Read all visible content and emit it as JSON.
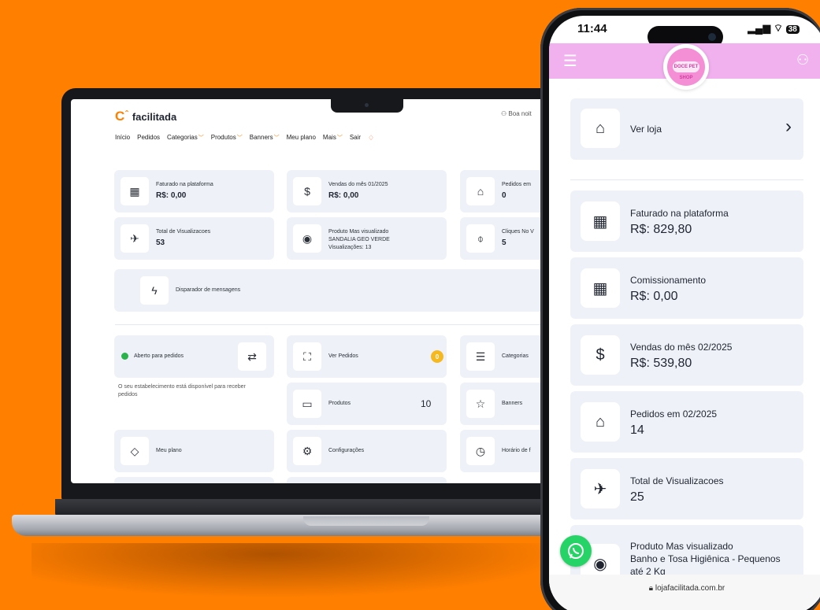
{
  "laptop": {
    "logo_text": "facilitada",
    "greeting": "Boa noit",
    "nav": [
      "Início",
      "Pedidos",
      "Categorias",
      "Produtos",
      "Banners",
      "Meu plano",
      "Mais",
      "Sair"
    ],
    "cards": {
      "faturado": {
        "label": "Faturado na plataforma",
        "value": "R$: 0,00"
      },
      "vendas": {
        "label": "Vendas do mês 01/2025",
        "value": "R$: 0,00"
      },
      "pedidos": {
        "label": "Pedidos em",
        "value": "0"
      },
      "visualizacoes": {
        "label": "Total de Visualizacoes",
        "value": "53"
      },
      "produto_mais": {
        "label": "Produto Mas visualizado",
        "line2": "SANDALIA GEO VERDE",
        "line3": "Visualizações: 13"
      },
      "cliques": {
        "label": "Cliques No V",
        "value": "5"
      },
      "disparador": {
        "label": "Disparador de mensagens"
      },
      "aberto": {
        "label": "Aberto para pedidos",
        "note": "O seu estabelecimento está disponível para receber pedidos"
      },
      "ver_pedidos": {
        "label": "Ver Pedidos",
        "badge": "0"
      },
      "categorias": {
        "label": "Categorias"
      },
      "produtos": {
        "label": "Produtos",
        "value": "10"
      },
      "banners": {
        "label": "Banners"
      },
      "meu_plano": {
        "label": "Meu plano"
      },
      "configuracoes": {
        "label": "Configurações"
      },
      "horario": {
        "label": "Horário de f"
      }
    }
  },
  "phone": {
    "time": "11:44",
    "battery": "38",
    "store_logo_text": "DOCE PET SHOP",
    "ver_loja": "Ver loja",
    "cards": [
      {
        "label": "Faturado na plataforma",
        "value": "R$: 829,80",
        "icon": "grid-icon"
      },
      {
        "label": "Comissionamento",
        "value": "R$: 0,00",
        "icon": "grid-icon"
      },
      {
        "label": "Vendas do mês 02/2025",
        "value": "R$: 539,80",
        "icon": "dollar-icon"
      },
      {
        "label": "Pedidos em 02/2025",
        "value": "14",
        "icon": "store-icon"
      },
      {
        "label": "Total de Visualizacoes",
        "value": "25",
        "icon": "rocket-icon"
      }
    ],
    "produto_mais": {
      "label": "Produto Mas visualizado",
      "line2": "Banho e Tosa Higiênica - Pequenos",
      "line3": "até 2 Kg"
    },
    "url": "lojafacilitada.com.br"
  },
  "colors": {
    "background": "#ff7f00",
    "card": "#eef2f8",
    "phone_header": "#f1b0ee",
    "accent": "#ff7f00",
    "whatsapp": "#25d366"
  }
}
